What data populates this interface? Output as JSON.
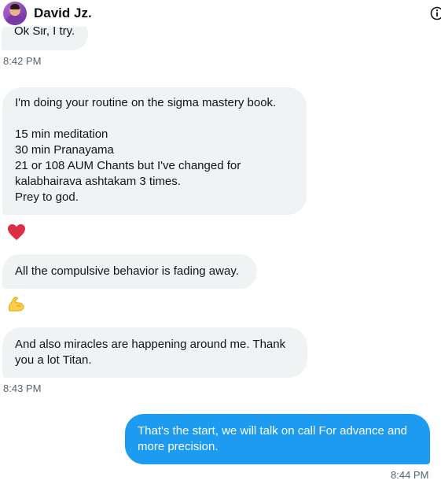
{
  "header": {
    "name": "David Jz.",
    "avatar": "profile-photo",
    "info_icon": "info-icon"
  },
  "messages": [
    {
      "direction": "in",
      "lines": [
        "Ok Sir, I try."
      ]
    },
    {
      "timestamp": "8:42 PM"
    },
    {
      "direction": "in",
      "lines": [
        "I'm doing your routine on the sigma mastery book.",
        "",
        "15 min meditation",
        "30 min Pranayama",
        "21 or 108 AUM Chants but I've changed for",
        "kalabhairava ashtakam 3 times.",
        "Prey to god."
      ]
    },
    {
      "reaction": "red-heart-emoji"
    },
    {
      "direction": "in",
      "lines": [
        "All the compulsive behavior is fading away."
      ]
    },
    {
      "reaction": "flexed-biceps-emoji"
    },
    {
      "direction": "in",
      "lines": [
        "And also miracles are happening around me. Thank",
        "you a lot Titan."
      ]
    },
    {
      "timestamp": "8:43 PM"
    },
    {
      "direction": "out",
      "lines": [
        "That's the start, we will talk on call For advance and",
        "more precision."
      ]
    },
    {
      "timestamp": "8:44 PM"
    }
  ],
  "colors": {
    "incoming_bubble": "#eff3f4",
    "outgoing_bubble": "#1d9bf0",
    "timestamp": "#536471",
    "text": "#0f1419"
  }
}
